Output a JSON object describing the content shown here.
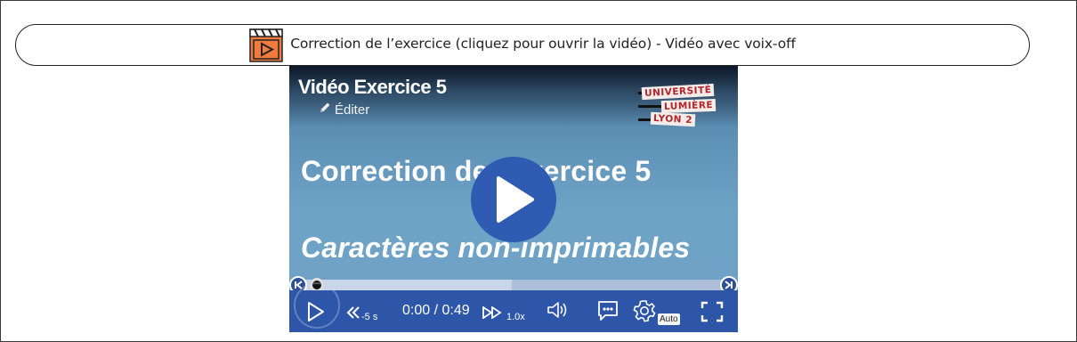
{
  "toggle": {
    "icon": "video-clapper-icon",
    "label": "Correction de l’exercice (cliquez pour ouvrir la vidéo) - Vidéo avec voix-off"
  },
  "player": {
    "title": "Vidéo Exercice 5",
    "edit_label": "Éditer",
    "logo": {
      "line1": "UNIVERSITÉ",
      "line2": "LUMIÈRE",
      "line3": "LYON 2"
    },
    "slide": {
      "line1": "Correction de l'exercice 5",
      "line2": "Caractères non-imprimables"
    },
    "progress_fraction": 0.0,
    "controls": {
      "rewind_label": "-5 s",
      "time": "0:00 / 0:49",
      "speed_label": "1.0x",
      "quality_label": "Auto"
    }
  },
  "colors": {
    "control_bar": "#2d56a8",
    "play_button": "#2f5bb2",
    "clapper_orange": "#f07b3f"
  }
}
